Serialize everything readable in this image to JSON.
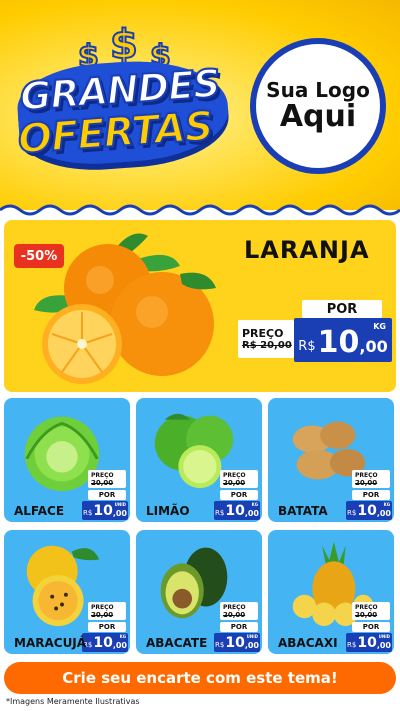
{
  "header": {
    "title_line1": "GRANDES",
    "title_line2": "OFERTAS",
    "logo_line1": "Sua Logo",
    "logo_line2": "Aqui"
  },
  "featured": {
    "discount_badge": "-50%",
    "name": "LARANJA",
    "por_label": "POR",
    "preco_label": "PREÇO",
    "old_price": "R$ 20,00",
    "currency": "R$",
    "price_int": "10",
    "price_dec": ",00",
    "unit": "KG"
  },
  "price_labels": {
    "preco": "PREÇO",
    "por": "POR",
    "currency": "R$"
  },
  "products": [
    {
      "name": "ALFACE",
      "old_price": "20,00",
      "price_int": "10",
      "price_dec": ",00",
      "unit": "UNID"
    },
    {
      "name": "LIMÃO",
      "old_price": "20,00",
      "price_int": "10",
      "price_dec": ",00",
      "unit": "KG"
    },
    {
      "name": "BATATA",
      "old_price": "20,00",
      "price_int": "10",
      "price_dec": ",00",
      "unit": "KG"
    },
    {
      "name": "MARACUJÁ",
      "old_price": "20,00",
      "price_int": "10",
      "price_dec": ",00",
      "unit": "KG"
    },
    {
      "name": "ABACATE",
      "old_price": "20,00",
      "price_int": "10",
      "price_dec": ",00",
      "unit": "UNID"
    },
    {
      "name": "ABACAXI",
      "old_price": "20,00",
      "price_int": "10",
      "price_dec": ",00",
      "unit": "UNID"
    }
  ],
  "cta": {
    "label": "Crie seu encarte com este tema!"
  },
  "disclaimer": "*Imagens Meramente Ilustrativas",
  "colors": {
    "brand_blue": "#1a3fb5",
    "card_blue": "#44b4f2",
    "yellow": "#ffd21c",
    "cta_orange": "#ff6a00",
    "badge_red": "#e8321f"
  }
}
